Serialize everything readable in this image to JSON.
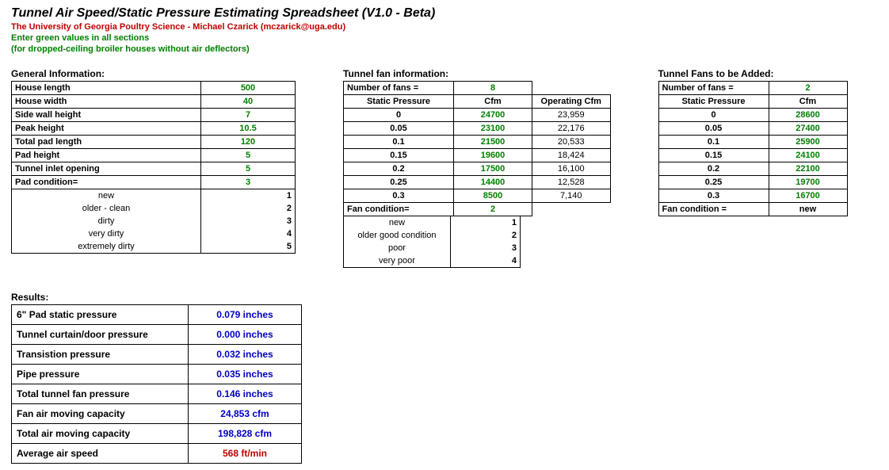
{
  "title": "Tunnel Air Speed/Static Pressure Estimating Spreadsheet  (V1.0 - Beta)",
  "subtitle_red": "The University of Georgia Poultry Science - Michael Czarick (mczarick@uga.edu)",
  "subtitle_green1": "Enter green values in all sections",
  "subtitle_green2": "(for dropped-ceiling broiler houses without air deflectors)",
  "general": {
    "header": "General Information:",
    "rows": [
      {
        "label": "House length",
        "value": "500"
      },
      {
        "label": "House width",
        "value": "40"
      },
      {
        "label": "Side wall height",
        "value": "7"
      },
      {
        "label": "Peak height",
        "value": "10.5"
      },
      {
        "label": "Total pad length",
        "value": "120"
      },
      {
        "label": "Pad height",
        "value": "5"
      },
      {
        "label": "Tunnel inlet opening",
        "value": "5"
      },
      {
        "label": "Pad condition=",
        "value": "3"
      }
    ],
    "pad_conditions": [
      {
        "name": "new",
        "num": "1"
      },
      {
        "name": "older - clean",
        "num": "2"
      },
      {
        "name": "dirty",
        "num": "3"
      },
      {
        "name": "very dirty",
        "num": "4"
      },
      {
        "name": "extremely dirty",
        "num": "5"
      }
    ]
  },
  "tunnel_fan": {
    "header": "Tunnel fan information:",
    "num_fans_label": "Number of fans =",
    "num_fans": "8",
    "col1": "Static Pressure",
    "col2": "Cfm",
    "col3": "Operating Cfm",
    "rows": [
      {
        "sp": "0",
        "cfm": "24700",
        "op": "23,959"
      },
      {
        "sp": "0.05",
        "cfm": "23100",
        "op": "22,176"
      },
      {
        "sp": "0.1",
        "cfm": "21500",
        "op": "20,533"
      },
      {
        "sp": "0.15",
        "cfm": "19600",
        "op": "18,424"
      },
      {
        "sp": "0.2",
        "cfm": "17500",
        "op": "16,100"
      },
      {
        "sp": "0.25",
        "cfm": "14400",
        "op": "12,528"
      },
      {
        "sp": "0.3",
        "cfm": "8500",
        "op": "7,140"
      }
    ],
    "fan_cond_label": "Fan condition=",
    "fan_cond_value": "2",
    "fan_conditions": [
      {
        "name": "new",
        "num": "1"
      },
      {
        "name": "older good condition",
        "num": "2"
      },
      {
        "name": "poor",
        "num": "3"
      },
      {
        "name": "very poor",
        "num": "4"
      }
    ]
  },
  "fans_added": {
    "header": "Tunnel Fans to be Added:",
    "num_fans_label": "Number of fans =",
    "num_fans": "2",
    "col1": "Static Pressure",
    "col2": "Cfm",
    "rows": [
      {
        "sp": "0",
        "cfm": "28600"
      },
      {
        "sp": "0.05",
        "cfm": "27400"
      },
      {
        "sp": "0.1",
        "cfm": "25900"
      },
      {
        "sp": "0.15",
        "cfm": "24100"
      },
      {
        "sp": "0.2",
        "cfm": "22100"
      },
      {
        "sp": "0.25",
        "cfm": "19700"
      },
      {
        "sp": "0.3",
        "cfm": "16700"
      }
    ],
    "fan_cond_label": "Fan condition =",
    "fan_cond_value": "new"
  },
  "results": {
    "header": "Results:",
    "rows": [
      {
        "label": "6\" Pad static pressure",
        "value": "0.079 inches",
        "cls": "val-blue"
      },
      {
        "label": "Tunnel curtain/door pressure",
        "value": "0.000 inches",
        "cls": "val-blue"
      },
      {
        "label": "Transistion pressure",
        "value": "0.032 inches",
        "cls": "val-blue"
      },
      {
        "label": "Pipe pressure",
        "value": "0.035 inches",
        "cls": "val-blue"
      },
      {
        "label": "Total tunnel fan pressure",
        "value": "0.146 inches",
        "cls": "val-blue"
      },
      {
        "label": "Fan air moving capacity",
        "value": "24,853 cfm",
        "cls": "val-blue"
      },
      {
        "label": "Total air moving capacity",
        "value": "198,828 cfm",
        "cls": "val-blue"
      },
      {
        "label": "Average air speed",
        "value": "568 ft/min",
        "cls": "val-red"
      }
    ]
  }
}
